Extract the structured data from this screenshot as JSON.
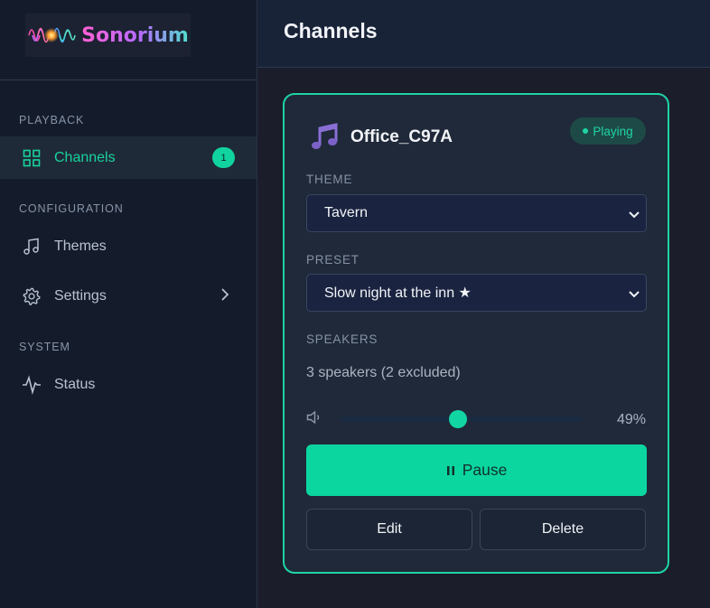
{
  "brand": {
    "name": "Sonorium"
  },
  "sidebar": {
    "sections": [
      {
        "label": "PLAYBACK"
      },
      {
        "label": "CONFIGURATION"
      },
      {
        "label": "SYSTEM"
      }
    ],
    "items": [
      {
        "label": "Channels",
        "icon": "grid-icon",
        "badge": "1",
        "active": true
      },
      {
        "label": "Themes",
        "icon": "music-note-icon"
      },
      {
        "label": "Settings",
        "icon": "gear-icon",
        "has_submenu": true
      },
      {
        "label": "Status",
        "icon": "activity-icon"
      }
    ]
  },
  "header": {
    "title": "Channels"
  },
  "channel": {
    "name": "Office_C97A",
    "icon": "musical-notes-icon",
    "status": "Playing",
    "theme_label": "THEME",
    "theme_value": "Tavern",
    "preset_label": "PRESET",
    "preset_value": "Slow night at the inn ★",
    "speakers_label": "SPEAKERS",
    "speakers_text": "3 speakers (2 excluded)",
    "volume_percent": 49,
    "volume_text": "49%",
    "pause_label": "Pause",
    "edit_label": "Edit",
    "delete_label": "Delete"
  },
  "colors": {
    "accent": "#0bd6a0",
    "sidebar_bg": "#141c2b",
    "card_bg": "#1f2939",
    "page_bg": "#1b1d2b"
  }
}
